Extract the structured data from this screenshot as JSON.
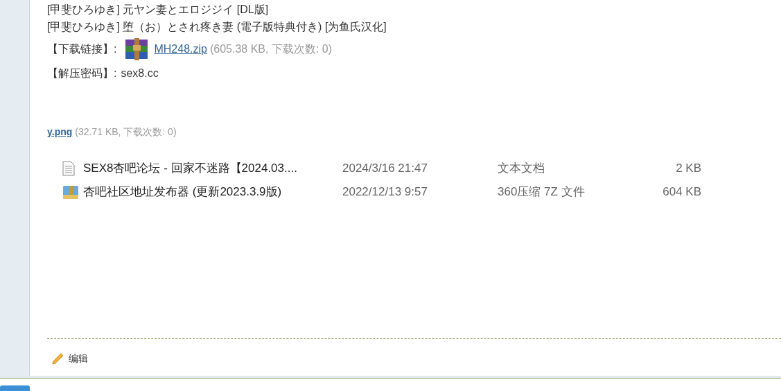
{
  "post": {
    "lines": [
      "[甲斐ひろゆき] 元ヤン妻とエロジジイ [DL版]",
      "[甲斐ひろゆき] 堕（お）とされ疼き妻 (電子版特典付き) [为鱼氏汉化]"
    ],
    "download": {
      "label": "【下载链接】:",
      "file": "MH248.zip",
      "info": "(605.38 KB, 下载次数: 0)"
    },
    "password": {
      "label": "【解压密码】:",
      "value": "sex8.cc"
    },
    "attachment": {
      "file": "y.png",
      "info": "(32.71 KB, 下载次数: 0)"
    },
    "files": [
      {
        "kind": "text",
        "name": "SEX8杏吧论坛 - 回家不迷路【2024.03....",
        "date": "2024/3/16 21:47",
        "type": "文本文档",
        "size": "2 KB"
      },
      {
        "kind": "archive",
        "name": "杏吧社区地址发布器 (更新2023.3.9版)",
        "date": "2022/12/13 9:57",
        "type": "360压缩 7Z 文件",
        "size": "604 KB"
      }
    ],
    "edit_label": "编辑"
  }
}
